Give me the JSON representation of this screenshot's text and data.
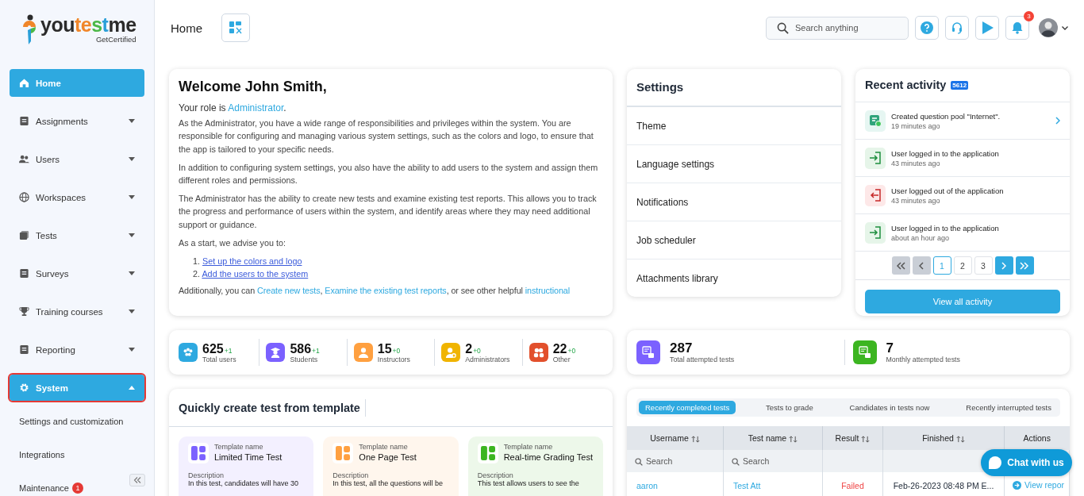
{
  "logo": {
    "parts": [
      {
        "text": "you",
        "color": "#2b2b2b"
      },
      {
        "text": "te",
        "color": "#f0862a"
      },
      {
        "text": "s",
        "color": "#4cb848"
      },
      {
        "text": "t",
        "color": "#2a9fd8"
      },
      {
        "text": "me",
        "color": "#2b2b2b"
      }
    ],
    "tagline": "GetCertified"
  },
  "header": {
    "title": "Home",
    "search": {
      "placeholder": "Search anything"
    },
    "notification_count": "3"
  },
  "sidebar": {
    "items": [
      {
        "label": "Home",
        "kind": "home",
        "selected": true,
        "expandable": false
      },
      {
        "label": "Assignments",
        "kind": "assign",
        "selected": false,
        "expandable": true,
        "expanded": false
      },
      {
        "label": "Users",
        "kind": "users",
        "selected": false,
        "expandable": true,
        "expanded": false
      },
      {
        "label": "Workspaces",
        "kind": "globe",
        "selected": false,
        "expandable": true,
        "expanded": false
      },
      {
        "label": "Tests",
        "kind": "tests",
        "selected": false,
        "expandable": true,
        "expanded": false
      },
      {
        "label": "Surveys",
        "kind": "survey",
        "selected": false,
        "expandable": true,
        "expanded": false
      },
      {
        "label": "Training courses",
        "kind": "trophy",
        "selected": false,
        "expandable": true,
        "expanded": false
      },
      {
        "label": "Reporting",
        "kind": "report",
        "selected": false,
        "expandable": true,
        "expanded": false
      },
      {
        "label": "System",
        "kind": "gear",
        "selected": true,
        "expandable": true,
        "expanded": true,
        "children": [
          {
            "label": "Settings and customization"
          },
          {
            "label": "Integrations"
          },
          {
            "label": "Maintenance",
            "badge": "1"
          }
        ]
      }
    ]
  },
  "welcome": {
    "title": "Welcome John Smith,",
    "role_prefix": "Your role is",
    "role": "Administrator",
    "role_suffix": ".",
    "paragraphs": [
      "As the Administrator, you have a wide range of responsibilities and privileges within the system. You are responsible for configuring and managing various system settings, such as the colors and logo, to ensure that the app is tailored to your specific needs.",
      "In addition to configuring system settings, you also have the ability to add users to the system and assign them different roles and permissions.",
      "The Administrator has the ability to create new tests and examine existing test reports. This allows you to track the progress and performance of users within the system, and identify areas where they may need additional support or guidance."
    ],
    "intro": "As a start, we advise you to:",
    "steps": [
      {
        "number": "1.",
        "text": "Set up the colors and logo"
      },
      {
        "number": "2.",
        "text": "Add the users to the system"
      }
    ],
    "closing": [
      {
        "text": "Additionally, you can ",
        "link": false
      },
      {
        "text": "Create new tests",
        "link": true
      },
      {
        "text": ", ",
        "link": false
      },
      {
        "text": "Examine the existing test reports",
        "link": true
      },
      {
        "text": ", or see other helpful ",
        "link": false
      },
      {
        "text": "instructional",
        "link": true
      }
    ]
  },
  "settings": {
    "title": "Settings",
    "items": [
      "Theme",
      "Language settings",
      "Notifications",
      "Job scheduler",
      "Attachments library"
    ]
  },
  "activity": {
    "title": "Recent activity",
    "count": "5612",
    "entries": [
      {
        "kind": "pool",
        "text": "Created question pool \"Internet\".",
        "time": "19 minutes ago",
        "has_link": true
      },
      {
        "kind": "login",
        "text": "User logged in to the application",
        "time": "43 minutes ago",
        "has_link": false
      },
      {
        "kind": "logout",
        "text": "User logged out of the application",
        "time": "43 minutes ago",
        "has_link": false
      },
      {
        "kind": "login",
        "text": "User logged in to the application",
        "time": "about an hour ago",
        "has_link": false
      }
    ],
    "pagination": {
      "first_disabled": true,
      "prev_disabled": true,
      "next_disabled": false,
      "last_disabled": false,
      "pages": [
        {
          "label": "1",
          "selected": true
        },
        {
          "label": "2",
          "selected": false
        },
        {
          "label": "3",
          "selected": false
        }
      ]
    },
    "button": "View all activity"
  },
  "user_stats": [
    {
      "kind": "total",
      "value": "625",
      "delta": "+1",
      "label": "Total users",
      "color": "#2ea9e0"
    },
    {
      "kind": "student",
      "value": "586",
      "delta": "+1",
      "label": "Students",
      "color": "#7b61ff"
    },
    {
      "kind": "instructor",
      "value": "15",
      "delta": "+0",
      "label": "Instructors",
      "color": "#ffa040"
    },
    {
      "kind": "admin",
      "value": "2",
      "delta": "+0",
      "label": "Administrators",
      "color": "#f0b400"
    },
    {
      "kind": "other",
      "value": "22",
      "delta": "+0",
      "label": "Other",
      "color": "#e2502c"
    }
  ],
  "test_stats": [
    {
      "value": "287",
      "label": "Total attempted tests",
      "color": "#7b61ff"
    },
    {
      "value": "7",
      "label": "Monthly attempted tests",
      "color": "#3cb521"
    }
  ],
  "templates": {
    "title": "Quickly create test from template",
    "items": [
      {
        "caption": "Template name",
        "name": "Limited Time Test",
        "description_label": "Description",
        "description": "In this test, candidates will have 30",
        "color": "#7b61ff"
      },
      {
        "caption": "Template name",
        "name": "One Page Test",
        "description_label": "Description",
        "description": "In this test, all the questions will be",
        "color": "#ffa040"
      },
      {
        "caption": "Template name",
        "name": "Real-time Grading Test",
        "description_label": "Description",
        "description": "This test allows users to see the",
        "color": "#3cb521"
      }
    ]
  },
  "tests_panel": {
    "tabs": [
      {
        "label": "Recently completed tests",
        "selected": true
      },
      {
        "label": "Tests to grade",
        "selected": false
      },
      {
        "label": "Candidates in tests now",
        "selected": false
      },
      {
        "label": "Recently interrupted tests",
        "selected": false
      }
    ],
    "columns": [
      {
        "label": "Username",
        "sortable": true,
        "search": {
          "placeholder": "Search"
        }
      },
      {
        "label": "Test name",
        "sortable": true,
        "search": {
          "placeholder": "Search"
        }
      },
      {
        "label": "Result",
        "sortable": true
      },
      {
        "label": "Finished",
        "sortable": true
      },
      {
        "label": "Actions",
        "sortable": false
      }
    ],
    "rows": [
      {
        "username": "aaron",
        "test": "Test Att",
        "result": "Failed",
        "kind": "failed",
        "finished": "Feb-26-2023 08:48 PM E...",
        "action": "View repor"
      }
    ]
  },
  "chat": {
    "label": "Chat with us"
  }
}
